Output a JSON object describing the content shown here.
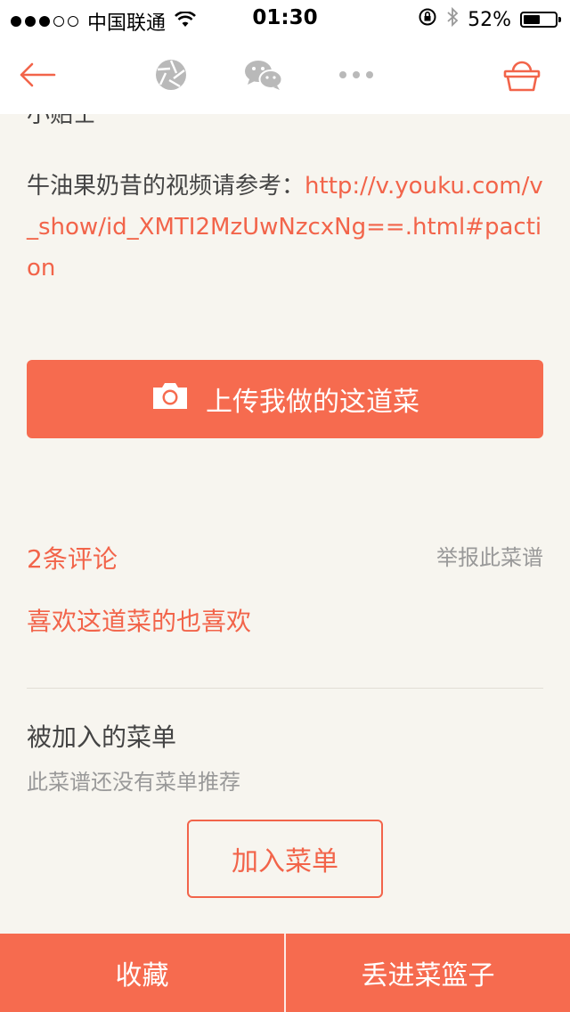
{
  "status_bar": {
    "carrier": "中国联通",
    "time": "01:30",
    "battery": "52%",
    "battery_level": 0.52
  },
  "nav": {
    "icons": [
      "back-arrow-icon",
      "aperture-icon",
      "wechat-icon",
      "more-icon",
      "basket-icon"
    ]
  },
  "tips": {
    "clipped_heading": "小贴士",
    "text": "牛油果奶昔的视频请参考：",
    "link": "http://v.youku.com/v_show/id_XMTI2MzUwNzcxNg==.html#paction"
  },
  "upload": {
    "label": "上传我做的这道菜",
    "icon": "camera-icon"
  },
  "comments": {
    "count_label": "2条评论",
    "report_label": "举报此菜谱"
  },
  "related": {
    "label": "喜欢这道菜的也喜欢"
  },
  "menus": {
    "title": "被加入的菜单",
    "empty_text": "此菜谱还没有菜单推荐",
    "add_button": "加入菜单"
  },
  "bottom_bar": {
    "favorite_label": "收藏",
    "basket_label": "丢进菜篮子"
  },
  "colors": {
    "accent": "#f66b4f",
    "link": "#f2644a",
    "background": "#f7f5ef"
  }
}
